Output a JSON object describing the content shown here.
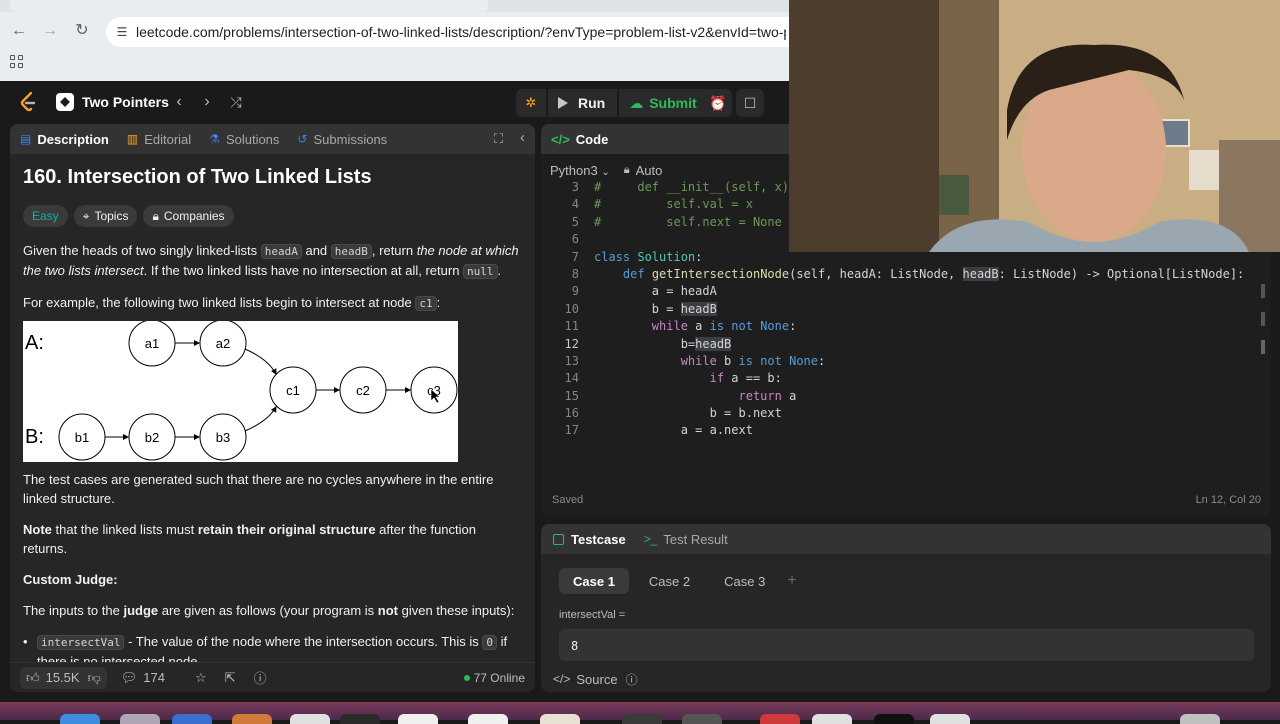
{
  "browser": {
    "url": "leetcode.com/problems/intersection-of-two-linked-lists/description/?envType=problem-list-v2&envId=two-pointe"
  },
  "header": {
    "problem_list": "Two Pointers",
    "run_label": "Run",
    "submit_label": "Submit"
  },
  "left": {
    "tabs": {
      "description": "Description",
      "editorial": "Editorial",
      "solutions": "Solutions",
      "submissions": "Submissions"
    },
    "title": "160. Intersection of Two Linked Lists",
    "tags": {
      "difficulty": "Easy",
      "topics": "Topics",
      "companies": "Companies"
    },
    "p1": {
      "a": "Given the heads of two singly linked-lists ",
      "c1": "headA",
      "b": " and ",
      "c2": "headB",
      "c": ", return ",
      "em": "the node at which the two lists intersect",
      "d": ". If the two linked lists have no intersection at all, return ",
      "c3": "null",
      "e": "."
    },
    "p2": {
      "a": "For example, the following two linked lists begin to intersect at node ",
      "c": "c1",
      "b": ":"
    },
    "figure": {
      "label_a": "A:",
      "label_b": "B:",
      "nodes": [
        "a1",
        "a2",
        "c1",
        "c2",
        "c3",
        "b1",
        "b2",
        "b3"
      ]
    },
    "p3": "The test cases are generated such that there are no cycles anywhere in the entire linked structure.",
    "p4": {
      "strong1": "Note",
      "a": " that the linked lists must ",
      "strong2": "retain their original structure",
      "b": " after the function returns."
    },
    "custom_judge": "Custom Judge:",
    "p5": {
      "a": "The inputs to the ",
      "strong1": "judge",
      "b": " are given as follows (your program is ",
      "strong2": "not",
      "c": " given these inputs):"
    },
    "li1": {
      "code": "intersectVal",
      "a": " - The value of the node where the intersection occurs. This is ",
      "code2": "0",
      "b": " if there is no intersected node."
    },
    "footer": {
      "likes": "15.5K",
      "comments": "174",
      "online": "77 Online"
    }
  },
  "code": {
    "header": "Code",
    "language": "Python3",
    "mode": "Auto",
    "status": "Saved",
    "cursor": "Ln 12, Col 20",
    "line_numbers": [
      "3",
      "4",
      "5",
      "6",
      "7",
      "8",
      "9",
      "10",
      "11",
      "12",
      "13",
      "14",
      "15",
      "16",
      "17"
    ]
  },
  "test": {
    "tab_testcase": "Testcase",
    "tab_result": "Test Result",
    "cases": [
      "Case 1",
      "Case 2",
      "Case 3"
    ],
    "param_label": "intersectVal =",
    "param_value": "8",
    "source_label": "Source"
  }
}
